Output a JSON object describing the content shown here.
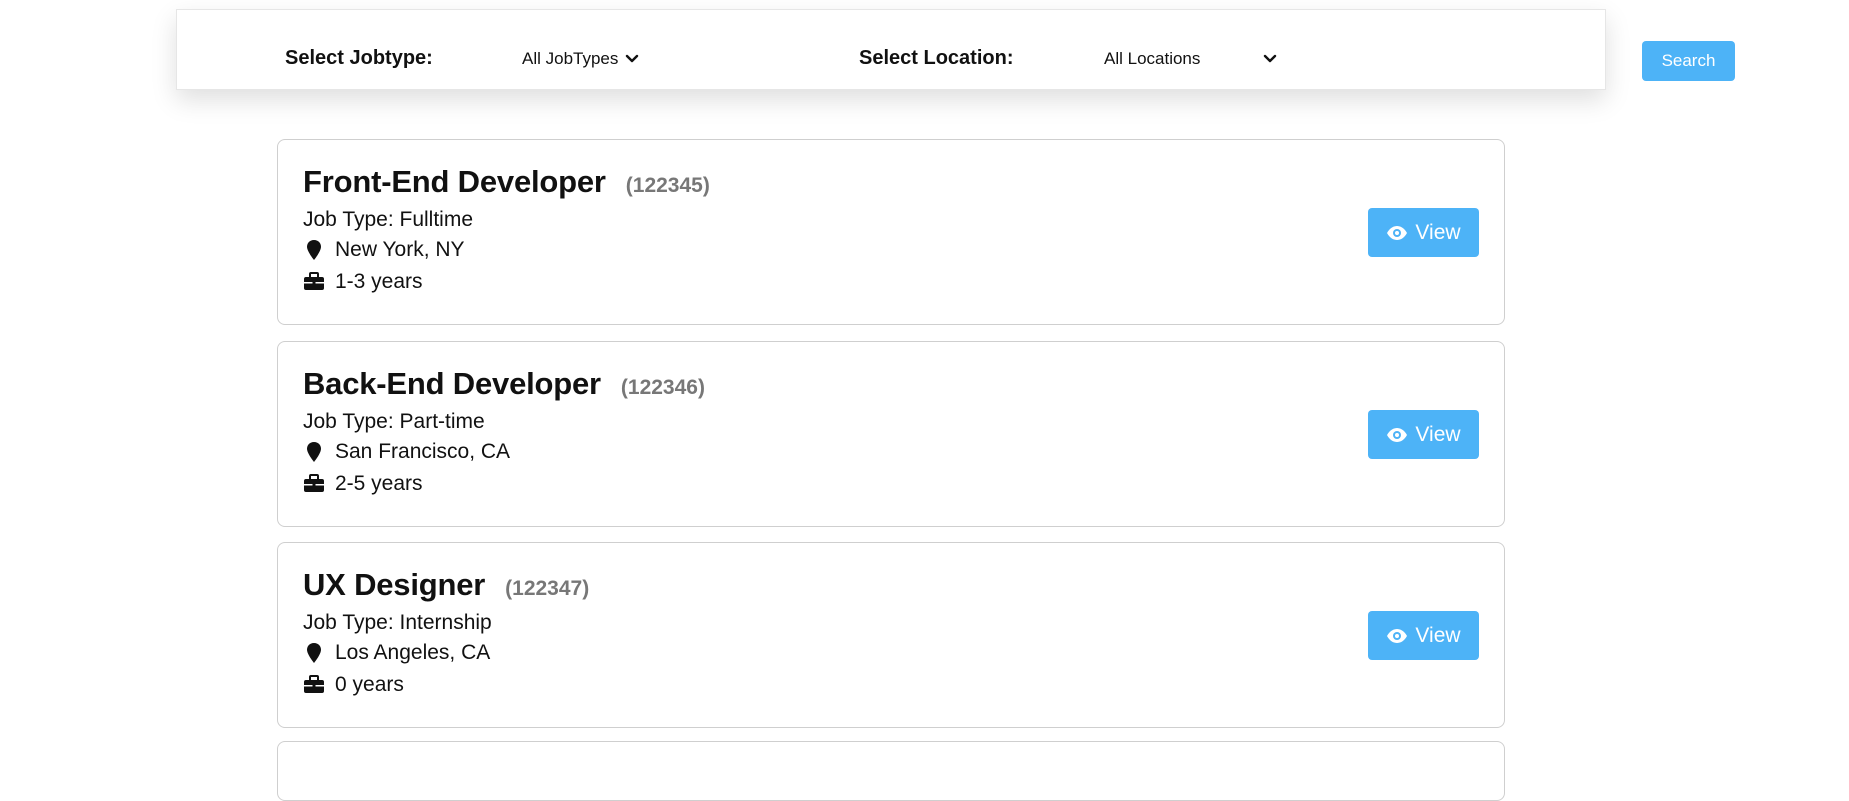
{
  "filters": {
    "jobtype_label": "Select Jobtype:",
    "jobtype_value": "All JobTypes",
    "location_label": "Select Location:",
    "location_value": "All Locations",
    "search_label": "Search"
  },
  "jobs": [
    {
      "title": "Front-End Developer",
      "id": "(122345)",
      "job_type": "Job Type: Fulltime",
      "location": "New York, NY",
      "experience": "1-3 years",
      "view_label": "View"
    },
    {
      "title": "Back-End Developer",
      "id": "(122346)",
      "job_type": "Job Type: Part-time",
      "location": "San Francisco, CA",
      "experience": "2-5 years",
      "view_label": "View"
    },
    {
      "title": "UX Designer",
      "id": "(122347)",
      "job_type": "Job Type: Internship",
      "location": "Los Angeles, CA",
      "experience": "0 years",
      "view_label": "View"
    }
  ],
  "icons": {
    "location": "map-marker-icon",
    "experience": "briefcase-icon",
    "view": "eye-icon",
    "dropdown": "chevron-down-icon"
  },
  "colors": {
    "accent": "#4db3f7",
    "job_id": "#777777",
    "card_border": "#cfcfcf"
  }
}
